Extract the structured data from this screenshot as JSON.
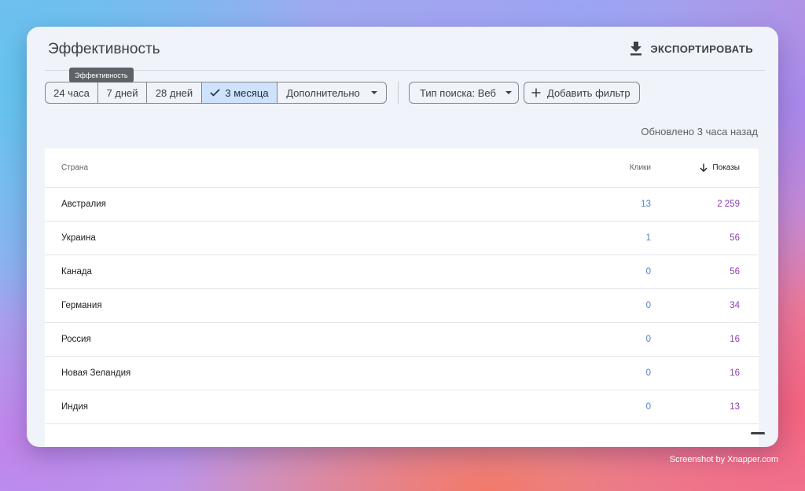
{
  "page": {
    "title": "Эффективность",
    "export_label": "ЭКСПОРТИРОВАТЬ",
    "tooltip": "Эффективность",
    "updated_text": "Обновлено 3 часа назад"
  },
  "date_filters": [
    {
      "label": "24 часа",
      "active": false
    },
    {
      "label": "7 дней",
      "active": false
    },
    {
      "label": "28 дней",
      "active": false
    },
    {
      "label": "3 месяца",
      "active": true
    },
    {
      "label": "Дополнительно",
      "active": false
    }
  ],
  "search_type": {
    "label": "Тип поиска: Веб"
  },
  "add_filter": {
    "label": "Добавить фильтр"
  },
  "table": {
    "headers": {
      "country": "Страна",
      "clicks": "Клики",
      "impressions": "Показы"
    },
    "rows": [
      {
        "country": "Австралия",
        "clicks": "13",
        "impressions": "2 259"
      },
      {
        "country": "Украина",
        "clicks": "1",
        "impressions": "56"
      },
      {
        "country": "Канада",
        "clicks": "0",
        "impressions": "56"
      },
      {
        "country": "Германия",
        "clicks": "0",
        "impressions": "34"
      },
      {
        "country": "Россия",
        "clicks": "0",
        "impressions": "16"
      },
      {
        "country": "Новая Зеландия",
        "clicks": "0",
        "impressions": "16"
      },
      {
        "country": "Индия",
        "clicks": "0",
        "impressions": "13"
      }
    ]
  },
  "watermark": "Screenshot by Xnapper.com",
  "colors": {
    "clicks": "#4a84cf",
    "impressions": "#8a3fb0",
    "active_filter": "#cfe2fb"
  },
  "icons": {
    "export": "download-icon",
    "check": "check-icon",
    "sort": "arrow-down-icon",
    "add": "plus-icon",
    "dropdown": "caret-down-icon"
  }
}
